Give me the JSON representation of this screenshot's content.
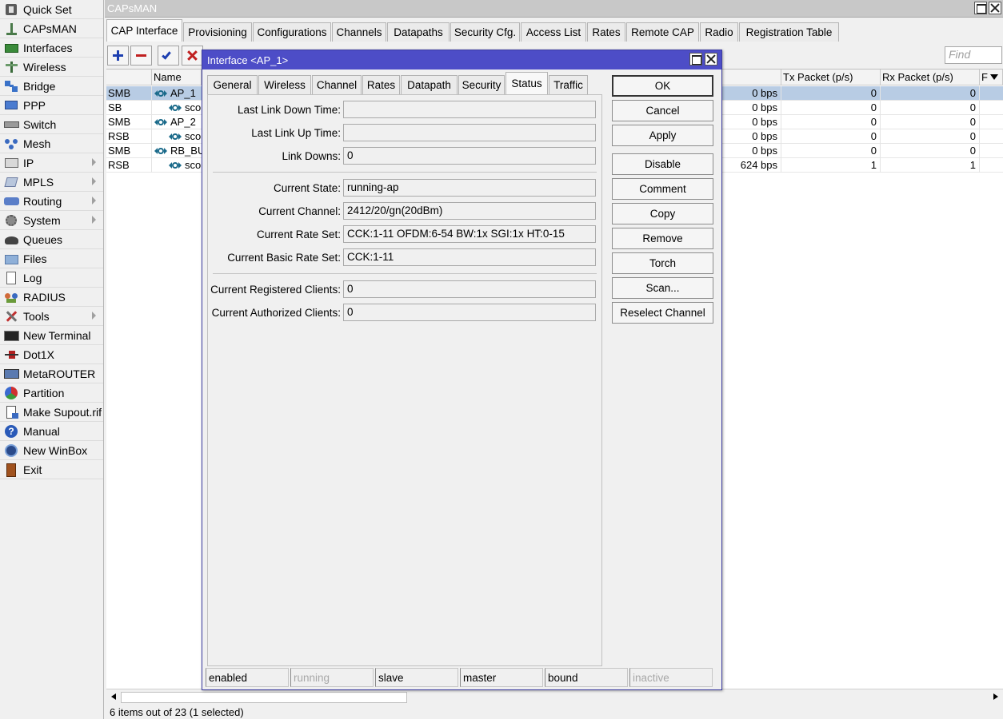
{
  "sidebar": {
    "items": [
      {
        "label": "Quick Set",
        "icon": "quick-set-icon",
        "submenu": false
      },
      {
        "label": "CAPsMAN",
        "icon": "capsman-icon",
        "submenu": false
      },
      {
        "label": "Interfaces",
        "icon": "interfaces-icon",
        "submenu": false
      },
      {
        "label": "Wireless",
        "icon": "wireless-icon",
        "submenu": false
      },
      {
        "label": "Bridge",
        "icon": "bridge-icon",
        "submenu": false
      },
      {
        "label": "PPP",
        "icon": "ppp-icon",
        "submenu": false
      },
      {
        "label": "Switch",
        "icon": "switch-icon",
        "submenu": false
      },
      {
        "label": "Mesh",
        "icon": "mesh-icon",
        "submenu": false
      },
      {
        "label": "IP",
        "icon": "ip-icon",
        "submenu": true
      },
      {
        "label": "MPLS",
        "icon": "mpls-icon",
        "submenu": true
      },
      {
        "label": "Routing",
        "icon": "routing-icon",
        "submenu": true
      },
      {
        "label": "System",
        "icon": "system-gear-icon",
        "submenu": true
      },
      {
        "label": "Queues",
        "icon": "queues-icon",
        "submenu": false
      },
      {
        "label": "Files",
        "icon": "folder-icon",
        "submenu": false
      },
      {
        "label": "Log",
        "icon": "log-icon",
        "submenu": false
      },
      {
        "label": "RADIUS",
        "icon": "radius-icon",
        "submenu": false
      },
      {
        "label": "Tools",
        "icon": "tools-icon",
        "submenu": true
      },
      {
        "label": "New Terminal",
        "icon": "terminal-icon",
        "submenu": false
      },
      {
        "label": "Dot1X",
        "icon": "dot1x-icon",
        "submenu": false
      },
      {
        "label": "MetaROUTER",
        "icon": "metarouter-icon",
        "submenu": false
      },
      {
        "label": "Partition",
        "icon": "partition-icon",
        "submenu": false
      },
      {
        "label": "Make Supout.rif",
        "icon": "supout-icon",
        "submenu": false
      },
      {
        "label": "Manual",
        "icon": "help-icon",
        "submenu": false
      },
      {
        "label": "New WinBox",
        "icon": "winbox-icon",
        "submenu": false
      },
      {
        "label": "Exit",
        "icon": "exit-door-icon",
        "submenu": false
      }
    ]
  },
  "window": {
    "title": "CAPsMAN",
    "tabs": [
      "CAP Interface",
      "Provisioning",
      "Configurations",
      "Channels",
      "Datapaths",
      "Security Cfg.",
      "Access List",
      "Rates",
      "Remote CAP",
      "Radio",
      "Registration Table"
    ],
    "active_tab": "CAP Interface",
    "find_placeholder": "Find"
  },
  "table": {
    "columns": [
      "",
      "Name",
      "",
      "Tx Packet (p/s)",
      "Rx Packet (p/s)",
      "F"
    ],
    "rows": [
      {
        "flags": "SMB",
        "name": "AP_1",
        "rate": "0 bps",
        "tx": "0",
        "rx": "0",
        "selected": true
      },
      {
        "flags": "SB",
        "name": "sco",
        "rate": "0 bps",
        "tx": "0",
        "rx": "0",
        "selected": false
      },
      {
        "flags": "SMB",
        "name": "AP_2",
        "rate": "0 bps",
        "tx": "0",
        "rx": "0",
        "selected": false
      },
      {
        "flags": "RSB",
        "name": "sco",
        "rate": "0 bps",
        "tx": "0",
        "rx": "0",
        "selected": false
      },
      {
        "flags": "SMB",
        "name": "RB_BU",
        "rate": "0 bps",
        "tx": "0",
        "rx": "0",
        "selected": false
      },
      {
        "flags": "RSB",
        "name": "sco",
        "rate": "624 bps",
        "tx": "1",
        "rx": "1",
        "selected": false
      }
    ]
  },
  "status_line": "6 items out of 23 (1 selected)",
  "dialog": {
    "title": "Interface <AP_1>",
    "tabs": [
      "General",
      "Wireless",
      "Channel",
      "Rates",
      "Datapath",
      "Security",
      "Status",
      "Traffic"
    ],
    "active_tab": "Status",
    "fields": {
      "last_link_down_time": {
        "label": "Last Link Down Time:",
        "value": ""
      },
      "last_link_up_time": {
        "label": "Last Link Up Time:",
        "value": ""
      },
      "link_downs": {
        "label": "Link Downs:",
        "value": "0"
      },
      "current_state": {
        "label": "Current State:",
        "value": "running-ap"
      },
      "current_channel": {
        "label": "Current Channel:",
        "value": "2412/20/gn(20dBm)"
      },
      "current_rate_set": {
        "label": "Current Rate Set:",
        "value": "CCK:1-11 OFDM:6-54 BW:1x SGI:1x HT:0-15"
      },
      "current_basic_rate_set": {
        "label": "Current Basic Rate Set:",
        "value": "CCK:1-11"
      },
      "current_registered_clients": {
        "label": "Current Registered Clients:",
        "value": "0"
      },
      "current_authorized_clients": {
        "label": "Current Authorized Clients:",
        "value": "0"
      }
    },
    "buttons": {
      "ok": "OK",
      "cancel": "Cancel",
      "apply": "Apply",
      "disable": "Disable",
      "comment": "Comment",
      "copy": "Copy",
      "remove": "Remove",
      "torch": "Torch",
      "scan": "Scan...",
      "reselect_channel": "Reselect Channel"
    },
    "status_bar": [
      {
        "text": "enabled",
        "active": true
      },
      {
        "text": "running",
        "active": false
      },
      {
        "text": "slave",
        "active": true
      },
      {
        "text": "master",
        "active": true
      },
      {
        "text": "bound",
        "active": true
      },
      {
        "text": "inactive",
        "active": false
      }
    ]
  },
  "colors": {
    "dialog_title_bar": "#4d4dc7",
    "selected_row": "#b8cce4",
    "window_background": "#f0f0f0"
  }
}
